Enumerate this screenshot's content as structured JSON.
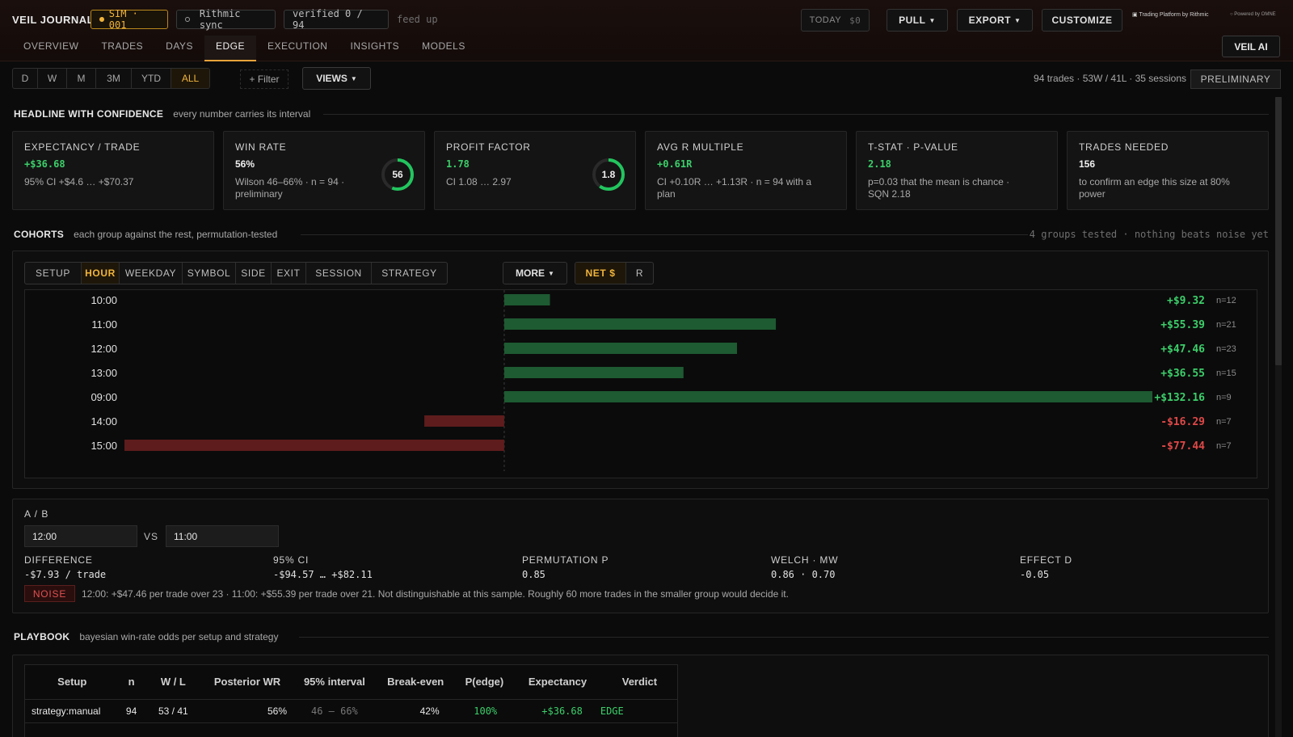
{
  "app": {
    "brand": "VEIL JOURNAL",
    "sim_label": "SIM · 001",
    "sync_label": "Rithmic sync",
    "verified_label": "verified 0 / 94",
    "feed_label": "feed up",
    "today_label": "TODAY",
    "today_value": "$0",
    "pull_label": "PULL",
    "export_label": "EXPORT",
    "customize_label": "CUSTOMIZE",
    "rithmic_label": "Trading Platform by Rithmic",
    "omne_label": "Powered by OMNE",
    "veil_ai_label": "VEIL AI"
  },
  "tabs": [
    {
      "label": "OVERVIEW",
      "active": false
    },
    {
      "label": "TRADES",
      "active": false
    },
    {
      "label": "DAYS",
      "active": false
    },
    {
      "label": "EDGE",
      "active": true
    },
    {
      "label": "EXECUTION",
      "active": false
    },
    {
      "label": "INSIGHTS",
      "active": false
    },
    {
      "label": "MODELS",
      "active": false
    }
  ],
  "ranges": [
    {
      "label": "D",
      "active": false
    },
    {
      "label": "W",
      "active": false
    },
    {
      "label": "M",
      "active": false
    },
    {
      "label": "3M",
      "active": false
    },
    {
      "label": "YTD",
      "active": false
    },
    {
      "label": "ALL",
      "active": true
    }
  ],
  "filter_label": "+ Filter",
  "views_label": "VIEWS",
  "summary": "94 trades · 53W / 41L · 35 sessions",
  "preliminary_label": "PRELIMINARY",
  "headline": {
    "title": "HEADLINE WITH CONFIDENCE",
    "subtitle": "every number carries its interval",
    "cards": [
      {
        "label": "EXPECTANCY / TRADE",
        "value": "+$36.68",
        "value_color": "green",
        "sub": "95% CI +$4.6 … +$70.37",
        "ring": null
      },
      {
        "label": "WIN RATE",
        "value": "56%",
        "value_color": "white",
        "sub": "Wilson 46–66% · n = 94 · preliminary",
        "ring": {
          "text": "56",
          "fraction": 0.56
        }
      },
      {
        "label": "PROFIT FACTOR",
        "value": "1.78",
        "value_color": "green",
        "sub": "CI 1.08 … 2.97",
        "ring": {
          "text": "1.8",
          "fraction": 0.6
        }
      },
      {
        "label": "AVG R MULTIPLE",
        "value": "+0.61R",
        "value_color": "green",
        "sub": "CI +0.10R … +1.13R · n = 94 with a plan",
        "ring": null
      },
      {
        "label": "T-STAT · P-VALUE",
        "value": "2.18",
        "value_color": "green",
        "sub": "p=0.03 that the mean is chance · SQN 2.18",
        "ring": null
      },
      {
        "label": "TRADES NEEDED",
        "value": "156",
        "value_color": "white",
        "sub": "to confirm an edge this size at 80% power",
        "ring": null
      }
    ]
  },
  "cohorts": {
    "title": "COHORTS",
    "subtitle": "each group against the rest, permutation-tested",
    "right_note": "4 groups tested · nothing beats noise yet",
    "groups": [
      {
        "label": "SETUP",
        "active": false
      },
      {
        "label": "HOUR",
        "active": true
      },
      {
        "label": "WEEKDAY",
        "active": false
      },
      {
        "label": "SYMBOL",
        "active": false
      },
      {
        "label": "SIDE",
        "active": false
      },
      {
        "label": "EXIT",
        "active": false
      },
      {
        "label": "SESSION",
        "active": false
      },
      {
        "label": "STRATEGY",
        "active": false
      }
    ],
    "more_label": "MORE",
    "metrics": [
      {
        "label": "NET $",
        "active": true
      },
      {
        "label": "R",
        "active": false
      }
    ]
  },
  "chart_data": {
    "type": "bar",
    "orientation": "horizontal",
    "categories": [
      "10:00",
      "11:00",
      "12:00",
      "13:00",
      "09:00",
      "14:00",
      "15:00"
    ],
    "values": [
      9.32,
      55.39,
      47.46,
      36.55,
      132.16,
      -16.29,
      -77.44
    ],
    "value_labels": [
      "+$9.32",
      "+$55.39",
      "+$47.46",
      "+$36.55",
      "+$132.16",
      "-$16.29",
      "-$77.44"
    ],
    "counts": [
      "n=12",
      "n=21",
      "n=23",
      "n=15",
      "n=9",
      "n=7",
      "n=7"
    ],
    "xlim": [
      -77.44,
      132.16
    ],
    "colors": {
      "positive": "#1e5a32",
      "negative": "#5e1c1c",
      "positive_text": "#3ccf6a",
      "negative_text": "#e04848"
    }
  },
  "ab": {
    "title": "A / B",
    "a_value": "12:00",
    "vs_label": "VS",
    "b_value": "11:00",
    "stats": [
      {
        "label": "DIFFERENCE",
        "value": "-$7.93 / trade"
      },
      {
        "label": "95% CI",
        "value": "-$94.57 … +$82.11"
      },
      {
        "label": "PERMUTATION P",
        "value": "0.85"
      },
      {
        "label": "WELCH · MW",
        "value": "0.86 · 0.70"
      },
      {
        "label": "EFFECT D",
        "value": "-0.05"
      }
    ],
    "noise_label": "NOISE",
    "noise_text": "12:00: +$47.46 per trade over 23  · 11:00: +$55.39 per trade over 21.  Not distinguishable at this sample. Roughly 60 more trades in the smaller group would decide it."
  },
  "playbook": {
    "title": "PLAYBOOK",
    "subtitle": "bayesian win-rate odds per setup and strategy",
    "columns": [
      "Setup",
      "n",
      "W / L",
      "Posterior WR",
      "95% interval",
      "Break-even",
      "P(edge)",
      "Expectancy",
      "Verdict"
    ],
    "rows": [
      {
        "setup": "strategy:manual",
        "n": "94",
        "wl": "53 / 41",
        "posterior": "56%",
        "interval": "46 – 66%",
        "breakeven": "42%",
        "pedge": "100%",
        "expectancy": "+$36.68",
        "verdict": "EDGE"
      }
    ]
  },
  "colors": {
    "accent": "#f0b43c",
    "positive": "#3ccf6a",
    "negative": "#e04848",
    "ring_green": "#22c55e"
  }
}
